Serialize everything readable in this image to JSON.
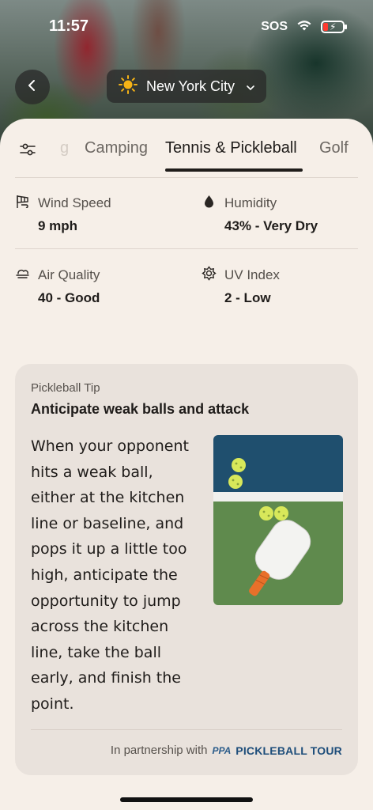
{
  "status_bar": {
    "time": "11:57",
    "carrier": "SOS",
    "wifi_icon": "wifi-icon",
    "battery_icon": "battery-charging-icon",
    "battery_color": "#ff3b30"
  },
  "header": {
    "back_icon": "chevron-left-icon",
    "location": {
      "weather_icon": "sun-icon",
      "city": "New York City",
      "dropdown_icon": "chevron-down-icon"
    }
  },
  "tabs": {
    "filter_icon": "sliders-icon",
    "items": [
      {
        "label": "g"
      },
      {
        "label": "Camping"
      },
      {
        "label": "Tennis & Pickleball"
      },
      {
        "label": "Golf"
      }
    ],
    "active_label": "Tennis & Pickleball"
  },
  "conditions": {
    "wind": {
      "icon": "windsock-icon",
      "label": "Wind Speed",
      "value": "9 mph"
    },
    "humidity": {
      "icon": "droplet-icon",
      "label": "Humidity",
      "value": "43% - Very Dry"
    },
    "air_quality": {
      "icon": "haze-icon",
      "label": "Air Quality",
      "value": "40 - Good"
    },
    "uv": {
      "icon": "sun-outline-icon",
      "label": "UV Index",
      "value": "2 - Low"
    }
  },
  "tip_card": {
    "eyebrow": "Pickleball Tip",
    "title": "Anticipate weak balls and attack",
    "body_lines": [
      "When your opponent",
      "hits a weak ball,",
      "either at the kitchen",
      "line or baseline, and",
      "pops it up a little too",
      "high, anticipate the",
      "opportunity to jump",
      "across the kitchen",
      "line, take the ball",
      "early, and finish the",
      "point."
    ],
    "image": "pickleball-paddle-balls-image",
    "partner_text": "In partnership with",
    "partner_logo": {
      "ppa": "PPA",
      "tour": "PICKLEBALL TOUR"
    }
  },
  "colors": {
    "background": "#f6efe8",
    "card": "#e9e2dc",
    "text": "#1f1c1a",
    "brand_blue": "#1d4d7a",
    "court_blue": "#1f4f6e",
    "court_green": "#5f8a4d"
  }
}
